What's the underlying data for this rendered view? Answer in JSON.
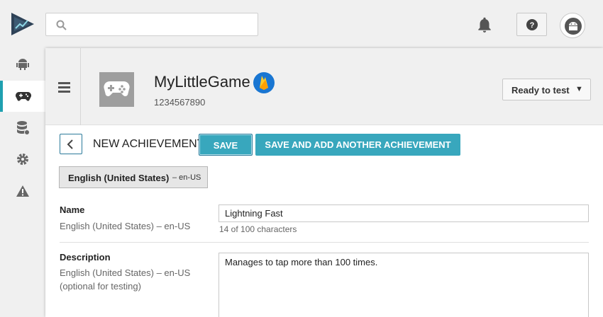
{
  "search": {
    "placeholder": "",
    "value": ""
  },
  "header": {
    "icons": [
      "play-console-logo",
      "search-icon",
      "bell-icon",
      "help-icon",
      "android-avatar-icon"
    ]
  },
  "rail": {
    "items": [
      {
        "name": "android-icon",
        "active": false
      },
      {
        "name": "gamepad-icon",
        "active": true
      },
      {
        "name": "database-icon",
        "active": false
      },
      {
        "name": "gear-icon",
        "active": false
      },
      {
        "name": "warning-icon",
        "active": false
      }
    ]
  },
  "app": {
    "title": "MyLittleGame",
    "id": "1234567890",
    "status": "Ready to test",
    "caret": "▼"
  },
  "toolbar": {
    "title": "NEW ACHIEVEMENT",
    "save_label": "SAVE",
    "save_add_label": "SAVE AND ADD ANOTHER ACHIEVEMENT"
  },
  "language_tab": {
    "name": "English (United States)",
    "code": "– en-US"
  },
  "form": {
    "name": {
      "label": "Name",
      "locale": "English (United States) – en-US",
      "value": "Lightning Fast",
      "counter": "14 of 100 characters"
    },
    "description": {
      "label": "Description",
      "locale": "English (United States) – en-US",
      "note": "(optional for testing)",
      "value": "Manages to tap more than 100 times."
    }
  },
  "colors": {
    "accent": "#38a7bd",
    "rail_active": "#1fa0b0",
    "firebase": "#1976d2"
  }
}
